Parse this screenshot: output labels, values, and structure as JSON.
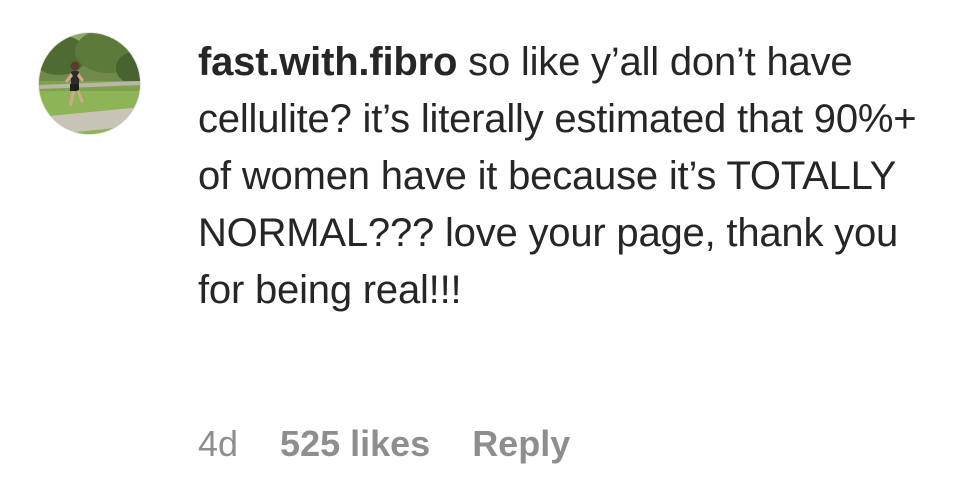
{
  "comment": {
    "username": "fast.with.fibro",
    "text": "so like y’all don’t have cellulite? it’s literally estimated that 90%+ of women have it because it’s TOTALLY NORMAL??? love your page, thank you for being real!!!",
    "time": "4d",
    "likes": "525 likes",
    "reply_label": "Reply",
    "avatar_icon": "runner-photo-avatar"
  },
  "colors": {
    "text": "#262626",
    "meta": "#8e8e8e",
    "background": "#ffffff"
  }
}
